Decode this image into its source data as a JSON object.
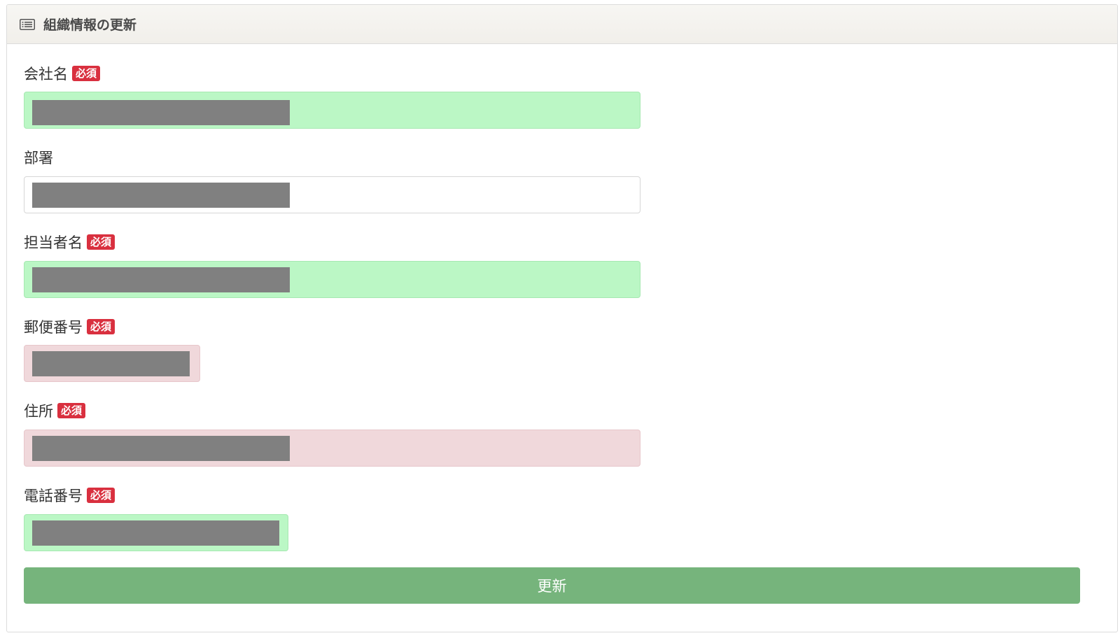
{
  "header": {
    "title": "組織情報の更新",
    "icon": "list-icon"
  },
  "required_badge": "必須",
  "fields": {
    "company_name": {
      "label": "会社名",
      "required": true,
      "state": "valid",
      "value": ""
    },
    "department": {
      "label": "部署",
      "required": false,
      "state": "neutral",
      "value": ""
    },
    "contact_name": {
      "label": "担当者名",
      "required": true,
      "state": "valid",
      "value": ""
    },
    "postal_code": {
      "label": "郵便番号",
      "required": true,
      "state": "invalid",
      "value": ""
    },
    "address": {
      "label": "住所",
      "required": true,
      "state": "invalid",
      "value": ""
    },
    "phone": {
      "label": "電話番号",
      "required": true,
      "state": "valid",
      "value": ""
    }
  },
  "submit": {
    "label": "更新"
  },
  "colors": {
    "valid_bg": "#bbf7c5",
    "invalid_bg": "#f0d8db",
    "badge": "#d9303f",
    "button": "#76b47c",
    "redaction": "#808080"
  }
}
